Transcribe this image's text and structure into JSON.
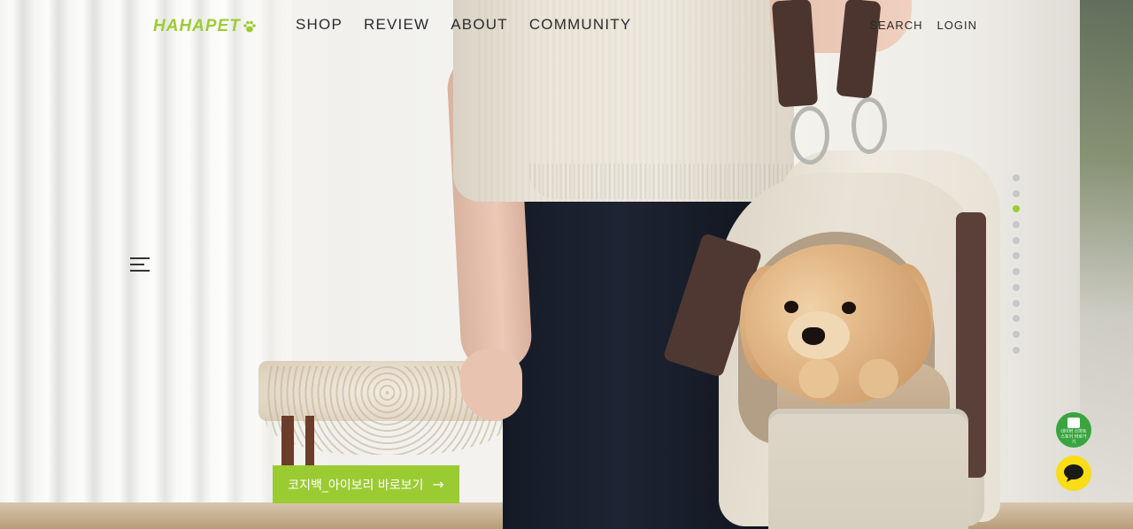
{
  "brand": {
    "logo_text": "HAHAPET",
    "accent_color": "#9ccc34"
  },
  "nav": {
    "items": [
      "SHOP",
      "REVIEW",
      "ABOUT",
      "COMMUNITY"
    ]
  },
  "utility": {
    "search_label": "SEARCH",
    "login_label": "LOGIN"
  },
  "menu": {
    "icon": "hamburger-icon"
  },
  "slider": {
    "total_slides": 12,
    "active_index": 2
  },
  "hero": {
    "cta_label": "코지백_아이보리 바로보기",
    "cta_arrow": "→"
  },
  "floating": {
    "naver_label": "네이버 스마트스토어 바로가기",
    "naver_icon": "naver-smartstore-icon",
    "kakao_icon": "kakao-talk-icon"
  }
}
